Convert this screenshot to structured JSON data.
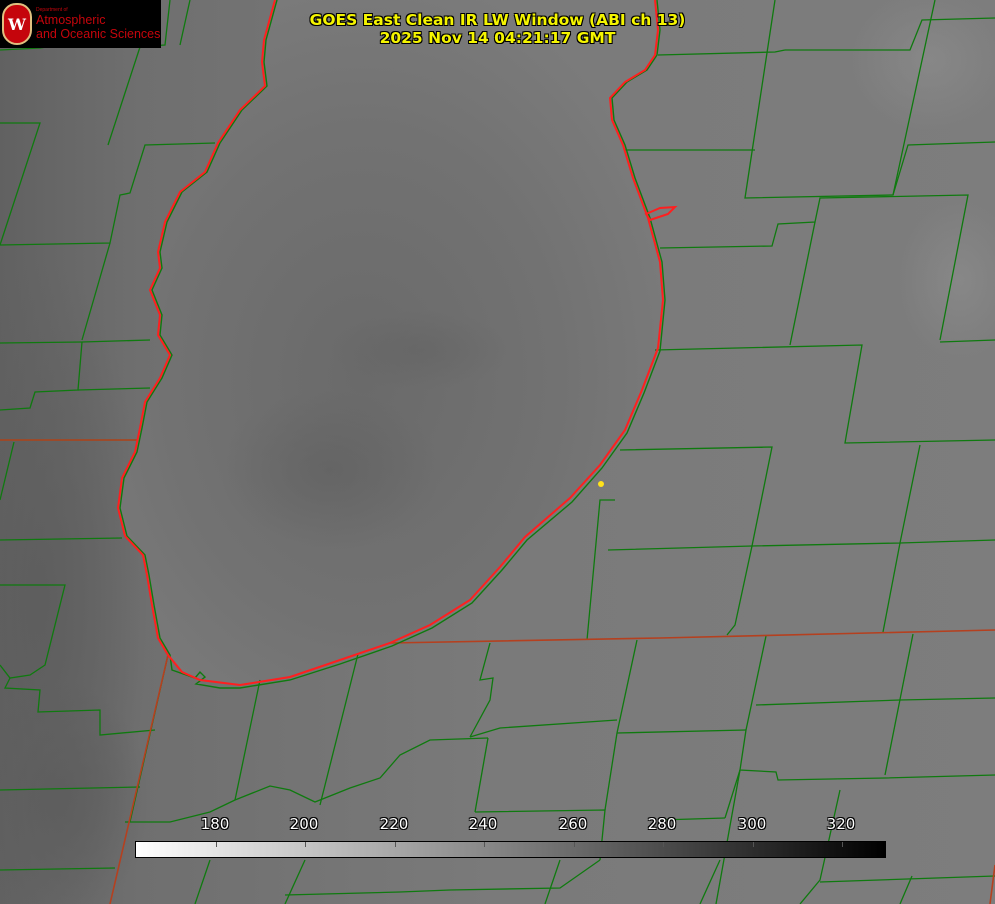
{
  "title_line1": "GOES East Clean IR LW Window (ABI ch 13)",
  "title_line2": "2025 Nov 14 04:21:17 GMT",
  "logo": {
    "department": "Department of",
    "line1": "Atmospheric",
    "line2": "and Oceanic Sciences",
    "seal_letter": "W"
  },
  "colorbar": {
    "ticks": [
      "180",
      "200",
      "220",
      "240",
      "260",
      "280",
      "300",
      "320"
    ],
    "colors": [
      "#ffffff",
      "#000000"
    ]
  },
  "colors": {
    "lake_outline": "#ff1f1f",
    "borders": "#0f7a0f",
    "marker": "#ffe21a",
    "title_text": "#f5f500",
    "logo_red": "#c5050c"
  }
}
